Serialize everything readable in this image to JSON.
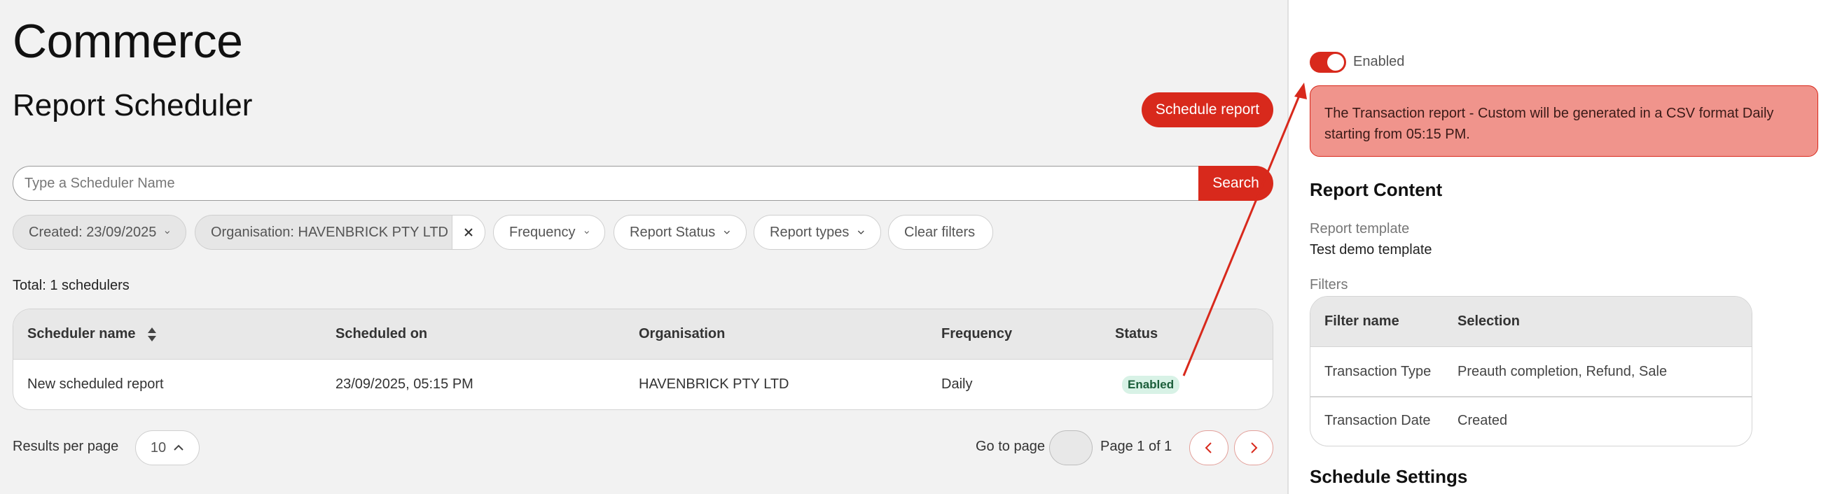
{
  "app": {
    "title": "Commerce"
  },
  "page": {
    "title": "Report Scheduler",
    "schedule_button": "Schedule report"
  },
  "search": {
    "placeholder": "Type a Scheduler Name",
    "value": "",
    "button": "Search"
  },
  "filters": {
    "created": "Created: 23/09/2025",
    "organisation": "Organisation: HAVENBRICK PTY LTD",
    "frequency": "Frequency",
    "report_status": "Report Status",
    "report_types": "Report types",
    "clear": "Clear filters"
  },
  "total": "Total: 1 schedulers",
  "table": {
    "headers": [
      "Scheduler name",
      "Scheduled on",
      "Organisation",
      "Frequency",
      "Status"
    ],
    "rows": [
      [
        "New scheduled report",
        "23/09/2025, 05:15 PM",
        "HAVENBRICK PTY LTD",
        "Daily",
        "Enabled"
      ]
    ]
  },
  "pagination": {
    "results_per_page_label": "Results per page",
    "results_per_page": "10",
    "goto_label": "Go to page",
    "goto_value": "",
    "page_info": "Page 1 of 1"
  },
  "detail": {
    "toggle_label": "Enabled",
    "toggle_on": true,
    "alert": "The Transaction report - Custom will be generated in a CSV format Daily starting from 05:15 PM.",
    "report_content_heading": "Report Content",
    "report_template_label": "Report template",
    "report_template_value": "Test demo template",
    "filters_label": "Filters",
    "filters_table": {
      "headers": [
        "Filter name",
        "Selection"
      ],
      "rows": [
        [
          "Transaction Type",
          "Preauth completion, Refund, Sale"
        ],
        [
          "Transaction Date",
          "Created"
        ]
      ]
    },
    "schedule_settings_heading": "Schedule Settings"
  },
  "colors": {
    "accent": "#d8291c",
    "alert_bg": "#f0948c",
    "badge_bg": "#d8f2e6",
    "badge_text": "#1b5e3a"
  },
  "icons": [
    "chevron-down-icon",
    "sort-icon",
    "close-icon",
    "chevron-up-icon",
    "chevron-left-icon",
    "chevron-right-icon",
    "arrow-annotation"
  ]
}
